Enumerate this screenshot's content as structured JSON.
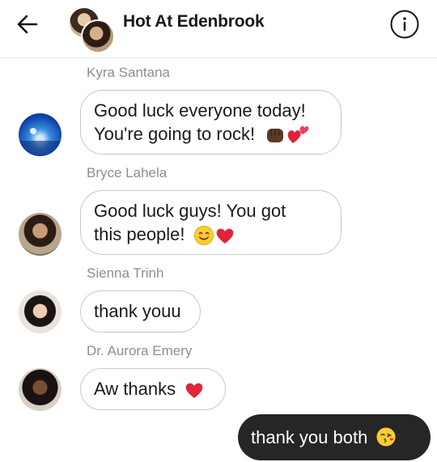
{
  "header": {
    "title": "Hot At Edenbrook",
    "back_icon": "arrow-left-icon",
    "info_icon": "info-circle-icon"
  },
  "messages": [
    {
      "sender": "Kyra Santana",
      "lines": [
        "Good luck everyone today!",
        "You're going to rock!"
      ],
      "emoji": [
        "fist-dark-emoji",
        "heart-revolving-emoji"
      ]
    },
    {
      "sender": "Bryce Lahela",
      "lines": [
        "Good luck guys! You got",
        "this people!"
      ],
      "emoji": [
        "smiling-face-emoji",
        "red-heart-emoji"
      ]
    },
    {
      "sender": "Sienna Trinh",
      "lines": [
        "thank youu"
      ]
    },
    {
      "sender": "Dr. Aurora Emery",
      "lines": [
        "Aw thanks"
      ],
      "emoji": [
        "red-heart-emoji"
      ]
    }
  ],
  "outgoing": {
    "text": "thank you both",
    "emoji": "face-blowing-kiss-emoji"
  },
  "colors": {
    "outgoing_bg": "#262626",
    "sender_name": "#8e8e8e",
    "bubble_border": "#c8c8c8",
    "heart": "#e0243a"
  }
}
